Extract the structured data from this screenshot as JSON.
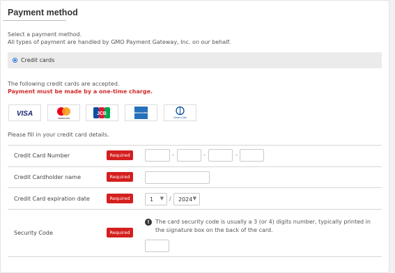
{
  "section": {
    "title": "Payment method",
    "intro_line1": "Select a payment method.",
    "intro_line2": "All types of payment are handled by GMO Payment Gateway, Inc. on our behalf."
  },
  "payment_method": {
    "selected_label": "Credit cards"
  },
  "accepted": {
    "line1": "The following credit cards are accepted.",
    "warning": "Payment must be made by a one-time charge."
  },
  "card_logos": [
    {
      "name": "visa",
      "text": "VISA"
    },
    {
      "name": "mastercard",
      "text": "mastercard"
    },
    {
      "name": "jcb",
      "text": "JCB"
    },
    {
      "name": "amex",
      "text": "AMERICAN EXPRESS"
    },
    {
      "name": "diners",
      "text": "Diners Club"
    }
  ],
  "instructions": "Please fill in your credit card details.",
  "form": {
    "required_label": "Required",
    "card_number_label": "Credit Card Number",
    "cardholder_label": "Credit Cardholder name",
    "expiration_label": "Credit Card expiration date",
    "expiration_month": "1",
    "expiration_year": "2024",
    "expiration_separator": "/",
    "security_label": "Security Code",
    "security_note": "The card security code is usually a 3 (or 4) digits number, typically printed in the signature box on the back of the card.",
    "number_separator": "-"
  },
  "colors": {
    "required_bg": "#d41f1f",
    "warning_text": "#d12c2c",
    "radio_accent": "#1e6ed6"
  }
}
